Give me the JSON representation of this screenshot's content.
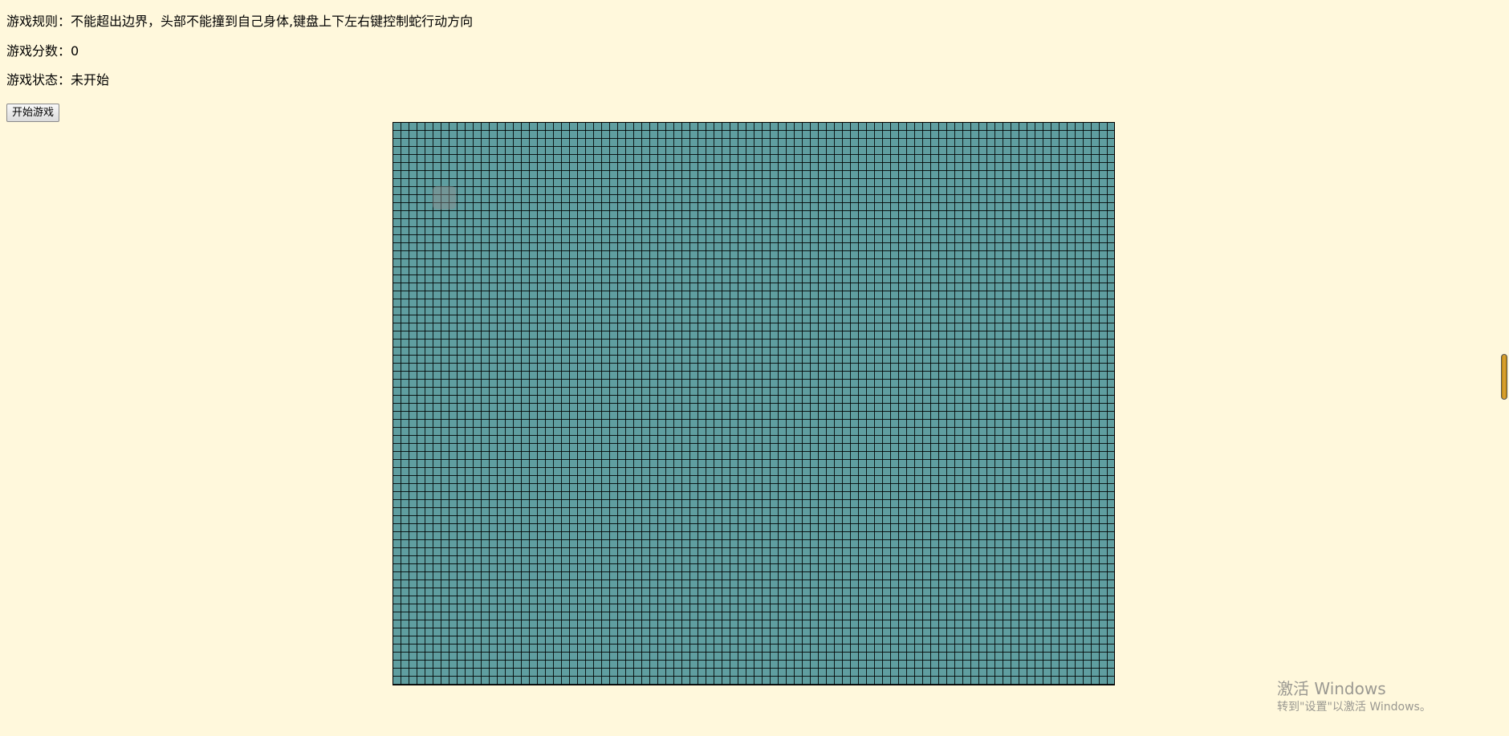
{
  "info": {
    "rules_label": "游戏规则：",
    "rules_text": "不能超出边界，头部不能撞到自己身体,键盘上下左右键控制蛇行动方向",
    "score_label": "游戏分数：",
    "score_value": "0",
    "status_label": "游戏状态：",
    "status_value": "未开始"
  },
  "controls": {
    "start_button_label": "开始游戏"
  },
  "board": {
    "background_color": "#5f9ea0",
    "grid_line_color": "#000000",
    "food_color": "#8c8c8c"
  },
  "watermark": {
    "title": "激活 Windows",
    "subtitle": "转到\"设置\"以激活 Windows。"
  },
  "colors": {
    "page_background": "#fff8dc"
  }
}
